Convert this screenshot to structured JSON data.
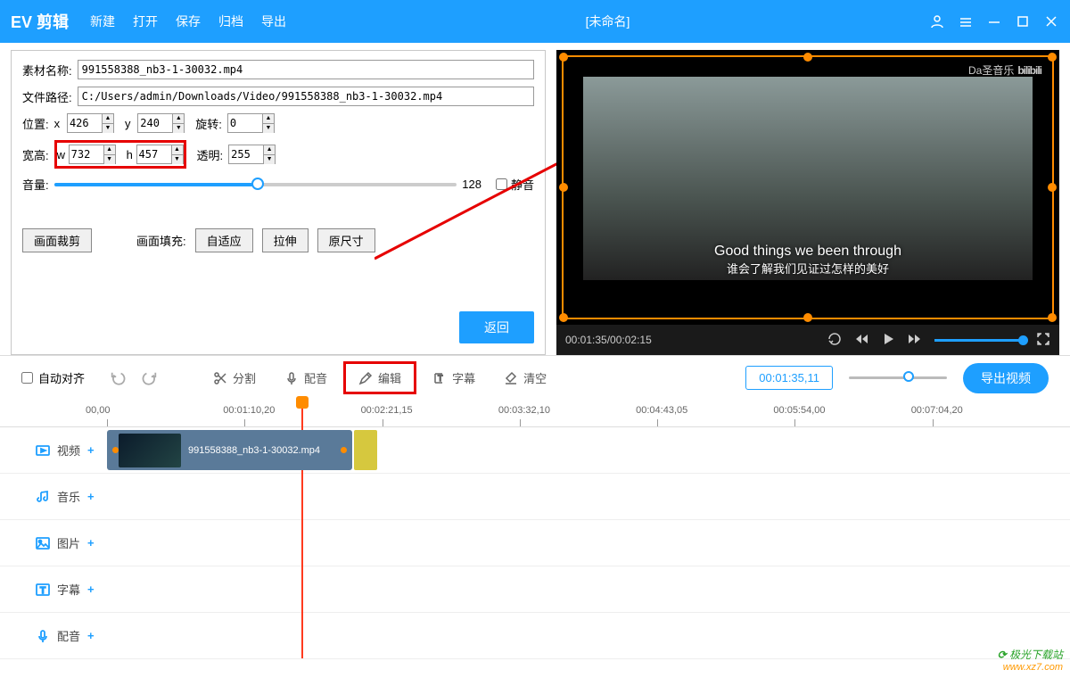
{
  "app_name": "EV 剪辑",
  "menu": [
    "新建",
    "打开",
    "保存",
    "归档",
    "导出"
  ],
  "doc_title": "[未命名]",
  "panel": {
    "name_label": "素材名称:",
    "name_value": "991558388_nb3-1-30032.mp4",
    "path_label": "文件路径:",
    "path_value": "C:/Users/admin/Downloads/Video/991558388_nb3-1-30032.mp4",
    "pos_label": "位置:",
    "pos_x_label": "x",
    "pos_x": "426",
    "pos_y_label": "y",
    "pos_y": "240",
    "rotate_label": "旋转:",
    "rotate": "0",
    "size_label": "宽高:",
    "size_w_label": "w",
    "size_w": "732",
    "size_h_label": "h",
    "size_h": "457",
    "alpha_label": "透明:",
    "alpha": "255",
    "vol_label": "音量:",
    "vol_value": "128",
    "mute_label": "静音",
    "crop_btn": "画面裁剪",
    "fill_label": "画面填充:",
    "fill_auto": "自适应",
    "fill_stretch": "拉伸",
    "fill_orig": "原尺寸",
    "return_btn": "返回"
  },
  "preview": {
    "watermark_text": "Da圣音乐",
    "subtitle_en": "Good things we been through",
    "subtitle_cn": "谁会了解我们见证过怎样的美好",
    "time": "00:01:35/00:02:15"
  },
  "toolbar": {
    "auto_align": "自动对齐",
    "split": "分割",
    "dub": "配音",
    "edit": "编辑",
    "subtitle": "字幕",
    "clear": "清空",
    "time": "00:01:35,11",
    "export": "导出视频"
  },
  "ruler": [
    "00,00",
    "00:01:10,20",
    "00:02:21,15",
    "00:03:32,10",
    "00:04:43,05",
    "00:05:54,00",
    "00:07:04,20"
  ],
  "tracks": {
    "video": "视频",
    "music": "音乐",
    "image": "图片",
    "sub": "字幕",
    "voice": "配音",
    "clip_name": "991558388_nb3-1-30032.mp4"
  },
  "site": {
    "name": "极光下载站",
    "url": "www.xz7.com"
  }
}
